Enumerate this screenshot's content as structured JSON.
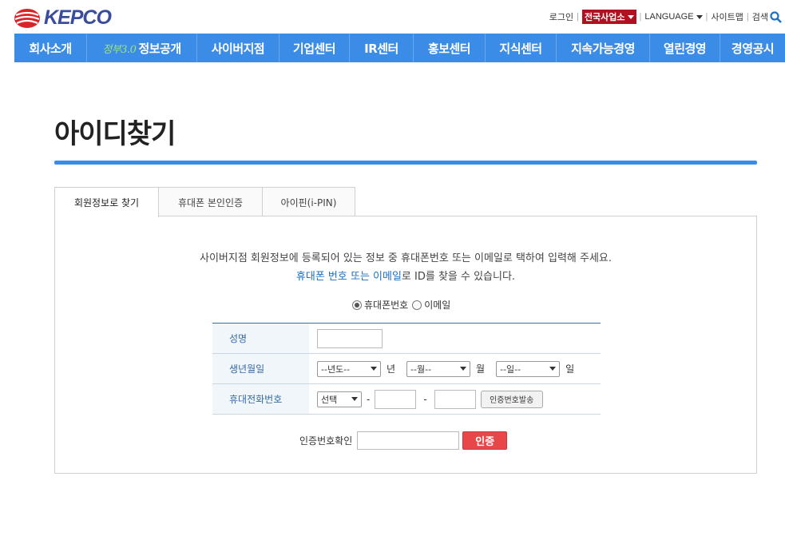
{
  "header": {
    "logo_text": "KEPCO",
    "utils": {
      "login": "로그인",
      "branch": "전국사업소",
      "language": "LANGUAGE",
      "sitemap": "사이트맵",
      "search": "검색"
    }
  },
  "gnb": {
    "items": [
      {
        "label": "회사소개"
      },
      {
        "prefix": "정부3.0",
        "label": "정보공개"
      },
      {
        "label": "사이버지점"
      },
      {
        "label": "기업센터"
      },
      {
        "label": "IR센터"
      },
      {
        "label": "홍보센터"
      },
      {
        "label": "지식센터"
      },
      {
        "label": "지속가능경영"
      },
      {
        "label": "열린경영"
      },
      {
        "label": "경영공시"
      }
    ]
  },
  "page": {
    "title": "아이디찾기"
  },
  "tabs": [
    {
      "label": "회원정보로 찾기",
      "active": true
    },
    {
      "label": "휴대폰 본인인증",
      "active": false
    },
    {
      "label": "아이핀(i-PIN)",
      "active": false
    }
  ],
  "intro": {
    "line1": "사이버지점 회원정보에 등록되어 있는 정보 중 휴대폰번호 또는 이메일로 택하여 입력해 주세요.",
    "line2_highlight": "휴대폰 번호 또는 이메일",
    "line2_rest": "로 ID를 찾을 수 있습니다."
  },
  "radios": {
    "phone": "휴대폰번호",
    "email": "이메일",
    "selected": "phone"
  },
  "form": {
    "name_label": "성명",
    "name_value": "",
    "birth_label": "생년월일",
    "year_select": "--년도--",
    "year_unit": "년",
    "month_select": "--월--",
    "month_unit": "월",
    "day_select": "--일--",
    "day_unit": "일",
    "phone_label": "휴대전화번호",
    "phone_prefix_select": "선택",
    "phone_mid": "",
    "phone_last": "",
    "dash": "-",
    "send_code_button": "인증번호발송"
  },
  "verify": {
    "label": "인증번호확인",
    "value": "",
    "button": "인증"
  }
}
